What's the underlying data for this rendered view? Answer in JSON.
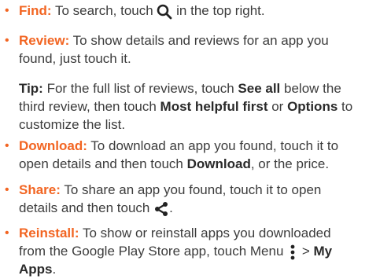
{
  "colors": {
    "accent": "#f26522",
    "text": "#3c3c3c"
  },
  "find": {
    "term": "Find:",
    "text_before": " To search, touch ",
    "icon": "search-icon",
    "text_after": " in the top right."
  },
  "review": {
    "term": "Review:",
    "line1": " To show details and reviews for an app you",
    "line2": "found, just touch it."
  },
  "tip": {
    "term": "Tip:",
    "line1_a": " For the full list of reviews, touch ",
    "line1_b": "See all",
    "line1_c": " below the",
    "line2_a": "third review, then touch ",
    "line2_b": "Most helpful first",
    "line2_c": " or ",
    "line2_d": "Options",
    "line2_e": " to",
    "line3": "customize the list."
  },
  "download": {
    "term": "Download:",
    "line1": " To download an app you found, touch it to",
    "line2_a": "open details and then touch ",
    "line2_b": "Download",
    "line2_c": ", or the price."
  },
  "share": {
    "term": "Share:",
    "line1": " To share an app you found, touch it to open",
    "line2_a": "details and then touch ",
    "icon": "share-icon",
    "line2_b": "."
  },
  "reinstall": {
    "term": "Reinstall:",
    "line1": " To show or reinstall apps you downloaded",
    "line2_a": "from the Google Play Store app, touch Menu ",
    "icon": "menu-icon",
    "line2_b": " > ",
    "line2_c": "My",
    "line3_a": "Apps",
    "line3_b": "."
  }
}
